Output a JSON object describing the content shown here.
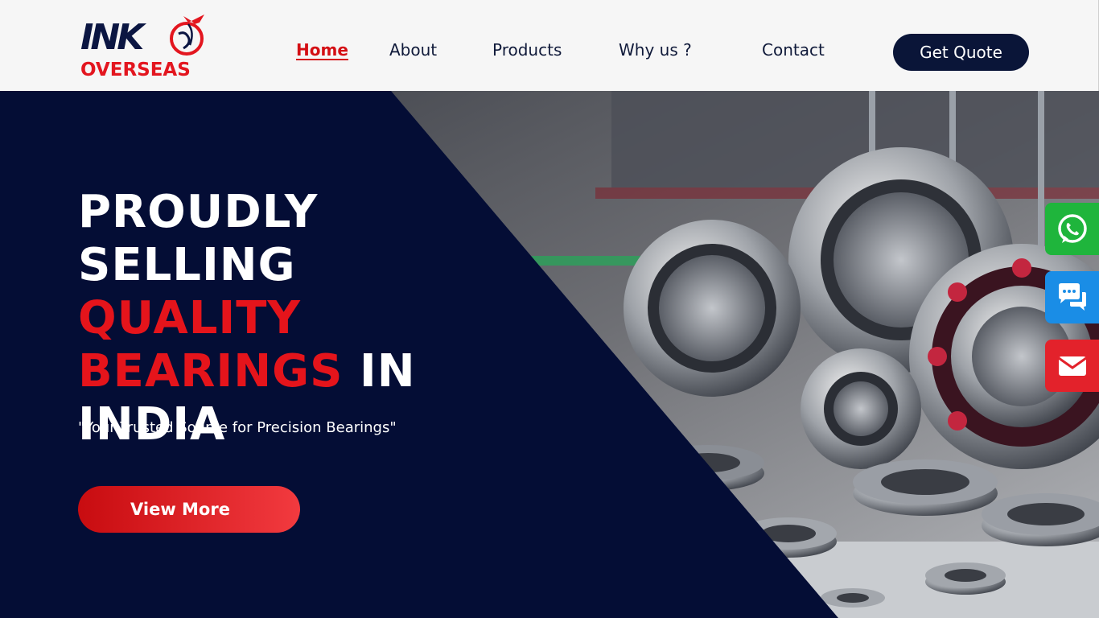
{
  "brand": {
    "logo_top": "INK",
    "logo_bottom": "OVERSEAS"
  },
  "nav": {
    "items": [
      {
        "label": "Home"
      },
      {
        "label": "About"
      },
      {
        "label": "Products"
      },
      {
        "label": "Why us ?"
      },
      {
        "label": "Contact"
      }
    ],
    "quote_label": "Get Quote"
  },
  "hero": {
    "line1": "PROUDLY",
    "line2a": "SELLING ",
    "line2b": "QUALITY",
    "line3a": "BEARINGS",
    "line3b": " IN",
    "line4": "INDIA",
    "tagline": "\"Your Trusted Source for Precision Bearings\"",
    "cta_label": "View More"
  },
  "side_buttons": [
    {
      "icon": "whatsapp-icon"
    },
    {
      "icon": "chat-icon"
    },
    {
      "icon": "mail-icon"
    }
  ],
  "colors": {
    "navy": "#0a1538",
    "accent_red": "#e5141b",
    "whatsapp_green": "#1fb53c",
    "chat_blue": "#1a8de6",
    "mail_red": "#e3222b"
  }
}
